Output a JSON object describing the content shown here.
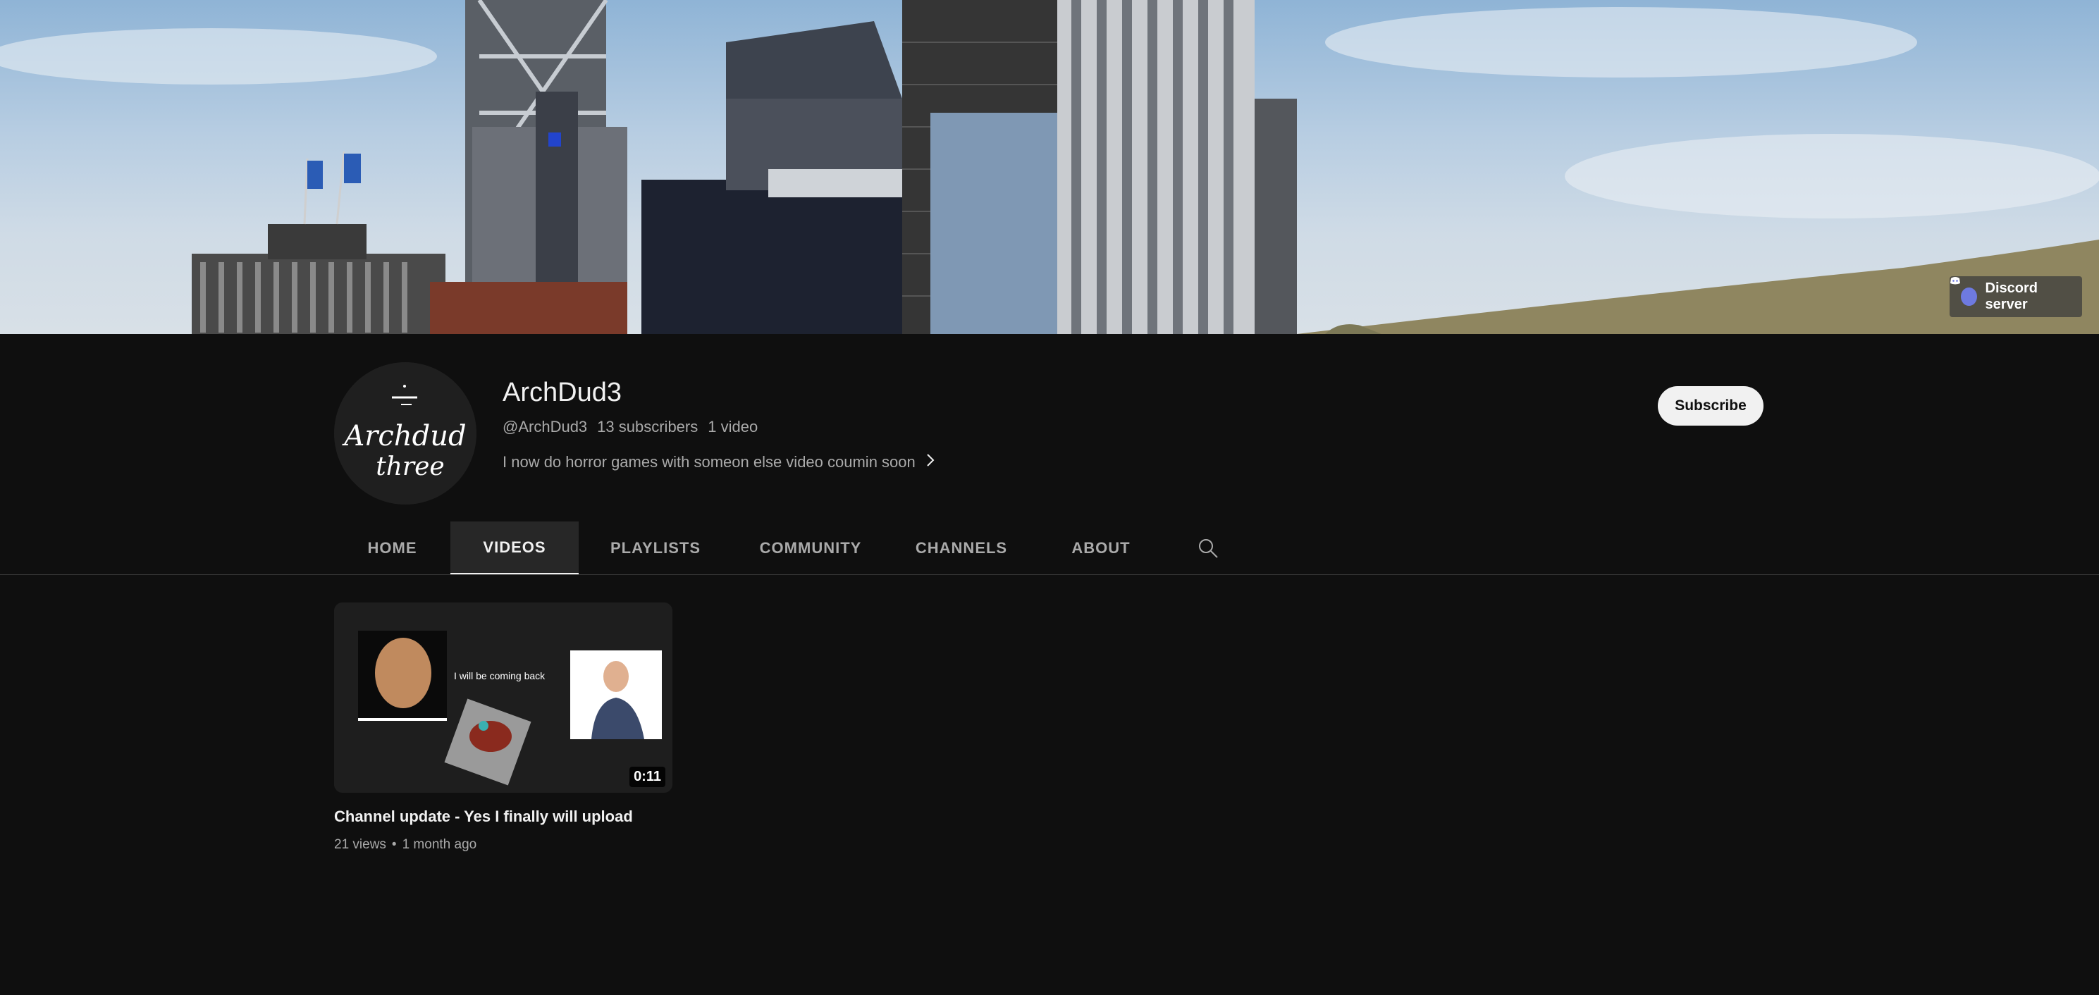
{
  "banner": {
    "link_label": "Discord server",
    "link_icon": "discord-icon"
  },
  "channel": {
    "name": "ArchDud3",
    "handle": "@ArchDud3",
    "subscribers": "13 subscribers",
    "video_count": "1 video",
    "description": "I now do horror games with someon else video coumin soon",
    "avatar_text_line1": "Archdud",
    "avatar_text_line2": "three",
    "subscribe_label": "Subscribe"
  },
  "tabs": [
    {
      "label": "HOME"
    },
    {
      "label": "VIDEOS"
    },
    {
      "label": "PLAYLISTS"
    },
    {
      "label": "COMMUNITY"
    },
    {
      "label": "CHANNELS"
    },
    {
      "label": "ABOUT"
    }
  ],
  "active_tab": "VIDEOS",
  "videos": [
    {
      "title": "Channel update - Yes I finally will upload",
      "views": "21 views",
      "separator": "•",
      "age": "1 month ago",
      "duration": "0:11",
      "thumbnail_caption": "I will be coming back"
    }
  ],
  "colors": {
    "background": "#0f0f0f",
    "active_tab_bg": "#272727",
    "text_primary": "#f1f1f1",
    "text_secondary": "#aaaaaa"
  }
}
